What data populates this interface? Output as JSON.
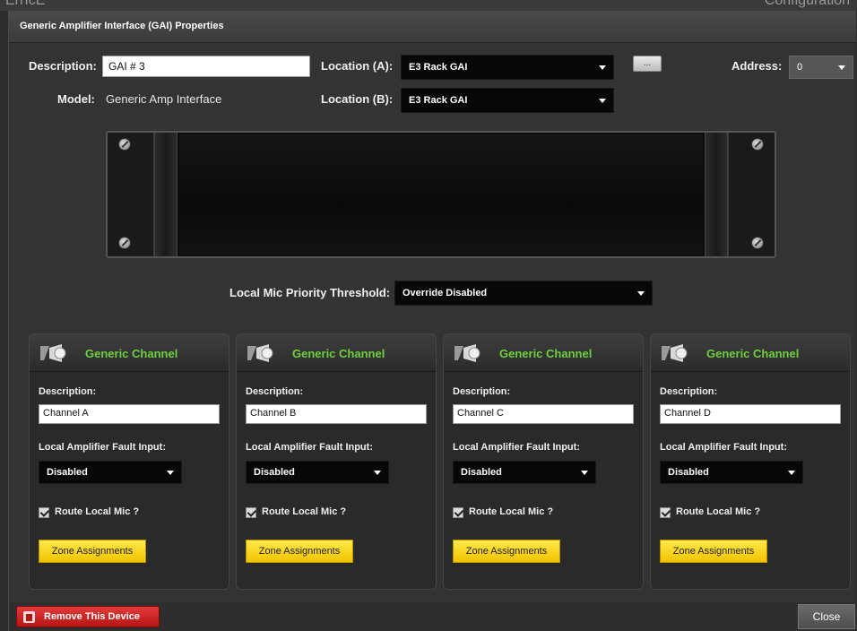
{
  "window": {
    "title": "Generic Amplifier Interface (GAI) Properties",
    "background_left_fragment": "ErrIcE",
    "background_right_fragment": "Configuration"
  },
  "properties": {
    "description_label": "Description:",
    "description_value": "GAI # 3",
    "model_label": "Model:",
    "model_value": "Generic Amp Interface",
    "location_a_label": "Location (A):",
    "location_a_value": "E3 Rack GAI",
    "location_b_label": "Location (B):",
    "location_b_value": "E3 Rack GAI",
    "ellipsis_button": "...",
    "address_label": "Address:",
    "address_value": "0"
  },
  "threshold": {
    "label": "Local Mic Priority Threshold:",
    "value": "Override Disabled"
  },
  "channels": [
    {
      "title": "Generic Channel",
      "description_label": "Description:",
      "description_value": "Channel A",
      "fault_label": "Local Amplifier Fault Input:",
      "fault_value": "Disabled",
      "route_label": "Route Local Mic ?",
      "route_checked": true,
      "zone_button": "Zone Assignments"
    },
    {
      "title": "Generic Channel",
      "description_label": "Description:",
      "description_value": "Channel B",
      "fault_label": "Local Amplifier Fault Input:",
      "fault_value": "Disabled",
      "route_label": "Route Local Mic ?",
      "route_checked": true,
      "zone_button": "Zone Assignments"
    },
    {
      "title": "Generic Channel",
      "description_label": "Description:",
      "description_value": "Channel C",
      "fault_label": "Local Amplifier Fault Input:",
      "fault_value": "Disabled",
      "route_label": "Route Local Mic ?",
      "route_checked": true,
      "zone_button": "Zone Assignments"
    },
    {
      "title": "Generic Channel",
      "description_label": "Description:",
      "description_value": "Channel D",
      "fault_label": "Local Amplifier Fault Input:",
      "fault_value": "Disabled",
      "route_label": "Route Local Mic ?",
      "route_checked": true,
      "zone_button": "Zone Assignments"
    }
  ],
  "footer": {
    "remove_label": "Remove This Device",
    "close_label": "Close"
  },
  "colors": {
    "channel_title": "#6ecf3f",
    "zone_button": "#ffe84a",
    "remove_button": "#d42727"
  },
  "icons": {
    "channel": "speaker-icon",
    "remove": "trash-icon",
    "dropdown": "chevron-down-icon"
  }
}
